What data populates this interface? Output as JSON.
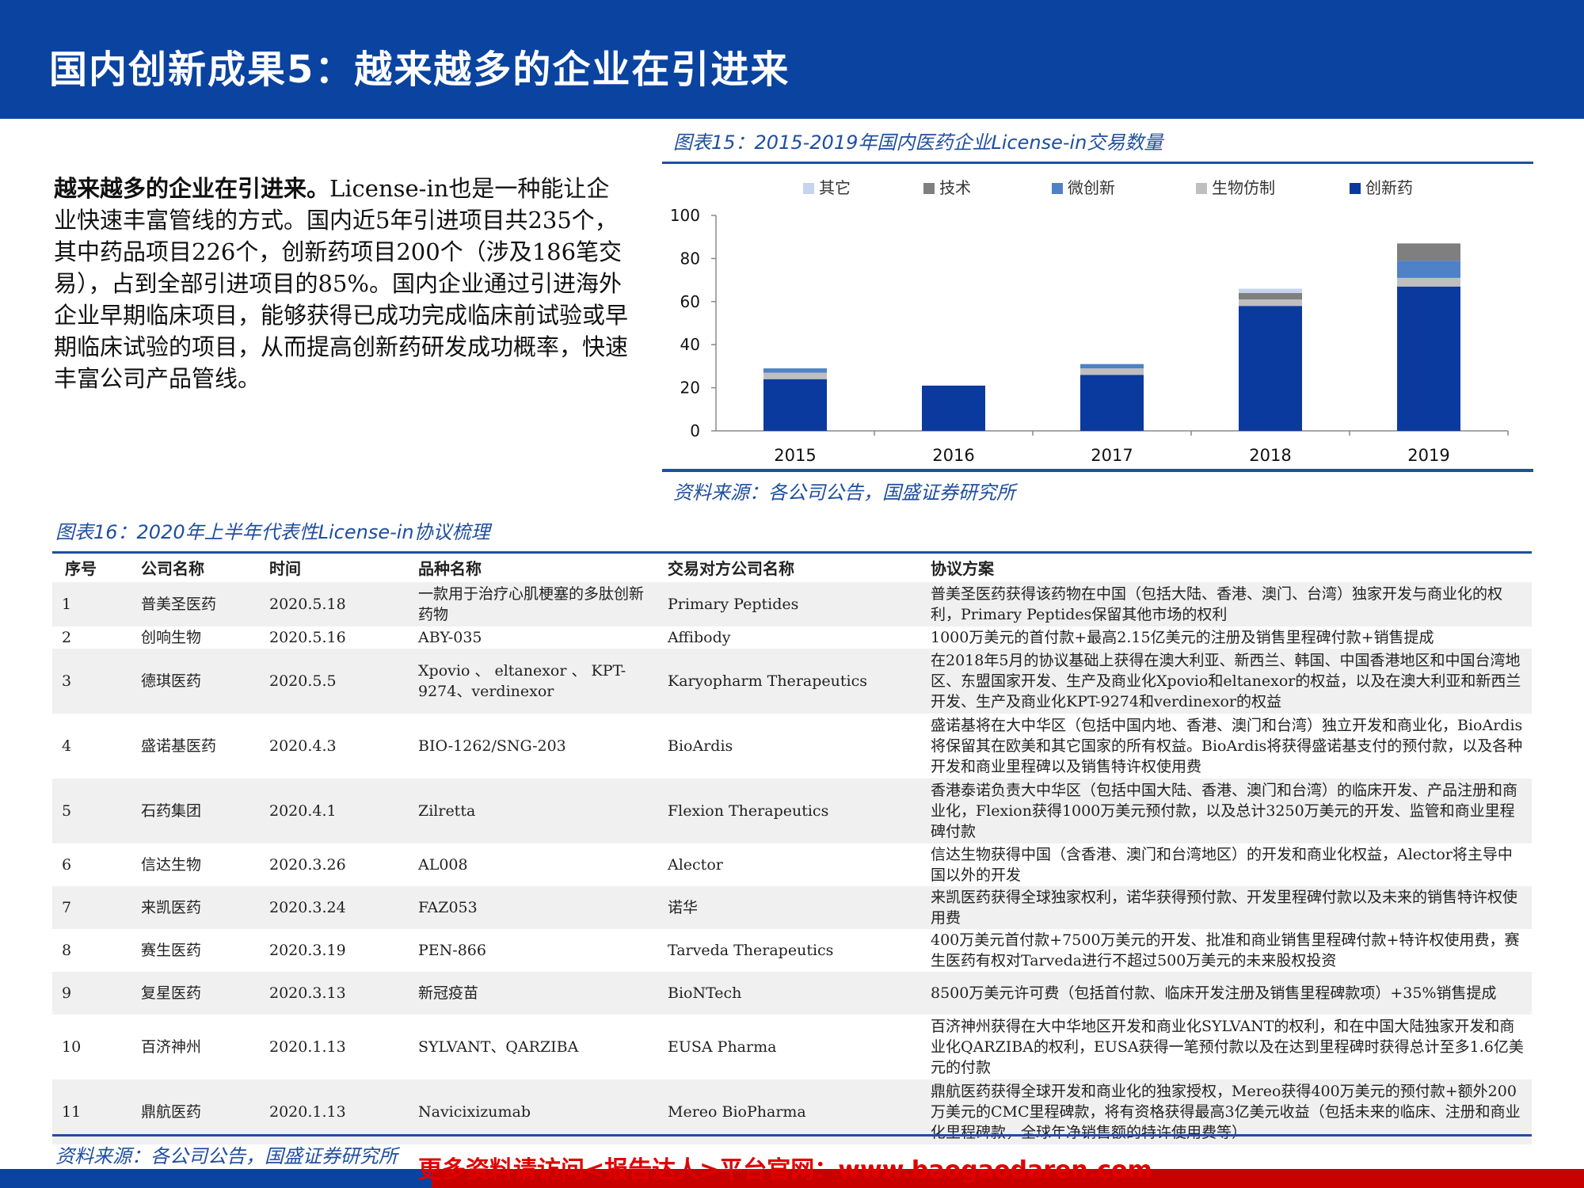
{
  "header": {
    "title": "国内创新成果5：越来越多的企业在引进来"
  },
  "intro": {
    "lead": "越来越多的企业在引进来。",
    "body": "License-in也是一种能让企业快速丰富管线的方式。国内近5年引进项目共235个，其中药品项目226个，创新药项目200个（涉及186笔交易），占到全部引进项目的85%。国内企业通过引进海外企业早期临床项目，能够获得已成功完成临床前试验或早期临床试验的项目，从而提高创新药研发成功概率，快速丰富公司产品管线。"
  },
  "figure15": {
    "title": "图表15：2015-2019年国内医药企业License-in交易数量",
    "source": "资料来源：各公司公告，国盛证券研究所"
  },
  "chart_data": {
    "type": "bar",
    "stacked": true,
    "categories": [
      "2015",
      "2016",
      "2017",
      "2018",
      "2019"
    ],
    "series": [
      {
        "name": "创新药",
        "color": "#0a3a9e",
        "values": [
          24,
          21,
          26,
          58,
          67
        ]
      },
      {
        "name": "生物仿制",
        "color": "#bfbfbf",
        "values": [
          3,
          0,
          3,
          3,
          4
        ]
      },
      {
        "name": "微创新",
        "color": "#4f81c7",
        "values": [
          2,
          0,
          2,
          0,
          8
        ]
      },
      {
        "name": "技术",
        "color": "#7f7f7f",
        "values": [
          0,
          0,
          0,
          3,
          8
        ]
      },
      {
        "name": "其它",
        "color": "#c5d5ee",
        "values": [
          0,
          0,
          0,
          2,
          0
        ]
      }
    ],
    "legend_order": [
      "其它",
      "技术",
      "微创新",
      "生物仿制",
      "创新药"
    ],
    "legend_position": "top",
    "ylim": [
      0,
      100
    ],
    "yticks": [
      0,
      20,
      40,
      60,
      80,
      100
    ],
    "grid": false
  },
  "figure16": {
    "title": "图表16：2020年上半年代表性License-in协议梳理",
    "source": "资料来源：各公司公告，国盛证券研究所",
    "headers": [
      "序号",
      "公司名称",
      "时间",
      "品种名称",
      "交易对方公司名称",
      "协议方案"
    ],
    "rows": [
      [
        "1",
        "普美圣医药",
        "2020.5.18",
        "一款用于治疗心肌梗塞的多肽创新药物",
        "Primary Peptides",
        "普美圣医药获得该药物在中国（包括大陆、香港、澳门、台湾）独家开发与商业化的权利，Primary Peptides保留其他市场的权利"
      ],
      [
        "2",
        "创响生物",
        "2020.5.16",
        "ABY-035",
        "Affibody",
        "1000万美元的首付款+最高2.15亿美元的注册及销售里程碑付款+销售提成"
      ],
      [
        "3",
        "德琪医药",
        "2020.5.5",
        "Xpovio 、 eltanexor 、 KPT-9274、verdinexor",
        "Karyopharm Therapeutics",
        "在2018年5月的协议基础上获得在澳大利亚、新西兰、韩国、中国香港地区和中国台湾地区、东盟国家开发、生产及商业化Xpovio和eltanexor的权益，以及在澳大利亚和新西兰开发、生产及商业化KPT-9274和verdinexor的权益"
      ],
      [
        "4",
        "盛诺基医药",
        "2020.4.3",
        "BIO-1262/SNG-203",
        "BioArdis",
        "盛诺基将在大中华区（包括中国内地、香港、澳门和台湾）独立开发和商业化，BioArdis将保留其在欧美和其它国家的所有权益。BioArdis将获得盛诺基支付的预付款，以及各种开发和商业里程碑以及销售特许权使用费"
      ],
      [
        "5",
        "石药集团",
        "2020.4.1",
        "Zilretta",
        "Flexion Therapeutics",
        "香港泰诺负责大中华区（包括中国大陆、香港、澳门和台湾）的临床开发、产品注册和商业化，Flexion获得1000万美元预付款，以及总计3250万美元的开发、监管和商业里程碑付款"
      ],
      [
        "6",
        "信达生物",
        "2020.3.26",
        "AL008",
        "Alector",
        "信达生物获得中国（含香港、澳门和台湾地区）的开发和商业化权益，Alector将主导中国以外的开发"
      ],
      [
        "7",
        "来凯医药",
        "2020.3.24",
        "FAZ053",
        "诺华",
        "来凯医药获得全球独家权利，诺华获得预付款、开发里程碑付款以及未来的销售特许权使用费"
      ],
      [
        "8",
        "赛生医药",
        "2020.3.19",
        "PEN-866",
        "Tarveda Therapeutics",
        "400万美元首付款+7500万美元的开发、批准和商业销售里程碑付款+特许权使用费，赛生医药有权对Tarveda进行不超过500万美元的未来股权投资"
      ],
      [
        "9",
        "复星医药",
        "2020.3.13",
        "新冠疫苗",
        "BioNTech",
        "8500万美元许可费（包括首付款、临床开发注册及销售里程碑款项）+35%销售提成"
      ],
      [
        "10",
        "百济神州",
        "2020.1.13",
        "SYLVANT、QARZIBA",
        "EUSA Pharma",
        "百济神州获得在大中华地区开发和商业化SYLVANT的权利，和在中国大陆独家开发和商业化QARZIBA的权利，EUSA获得一笔预付款以及在达到里程碑时获得总计至多1.6亿美元的付款"
      ],
      [
        "11",
        "鼎航医药",
        "2020.1.13",
        "Navicixizumab",
        "Mereo BioPharma",
        "鼎航医药获得全球开发和商业化的独家授权，Mereo获得400万美元的预付款+额外200万美元的CMC里程碑款，将有资格获得最高3亿美元收益（包括未来的临床、注册和商业化里程碑款，全球年净销售额的特许使用费等）"
      ]
    ]
  },
  "watermark": "更多资料请访问<报告达人>平台官网：www.baogaodaren.com"
}
